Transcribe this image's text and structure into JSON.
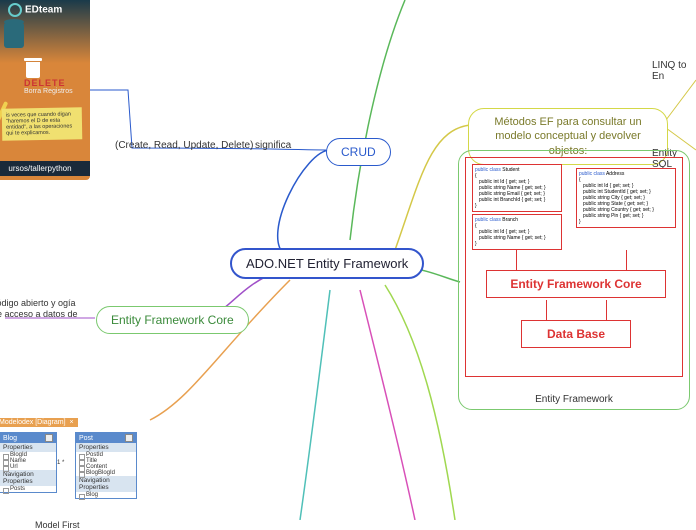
{
  "center": {
    "title": "ADO.NET Entity Framework"
  },
  "crud": {
    "label": "CRUD",
    "meaning_label": "significa",
    "expansion": "(Create, Read, Update, Delete)"
  },
  "efc": {
    "label": "Entity Framework Core",
    "description": "código abierto y\nogía de acceso a datos de"
  },
  "metodos": {
    "label": "Métodos EF para consultar un modelo conceptual y devolver objetos:",
    "child1": "LINQ to En",
    "child2": "Entity SQL"
  },
  "ef_diagram": {
    "caption": "Entity Framework",
    "efc_label": "Entity Framework Core",
    "db_label": "Data Base",
    "class_student": {
      "decl": "public class Student",
      "props": [
        "public int Id { get; set; }",
        "public string Name { get; set; }",
        "public string Email { get; set; }",
        "public int BranchId { get; set; }"
      ]
    },
    "class_branch": {
      "decl": "public class Branch",
      "props": [
        "public int Id { get; set; }",
        "public string Name { get; set; }"
      ]
    },
    "class_address": {
      "decl": "public class Address",
      "props": [
        "public int Id { get; set; }",
        "public int StudentId { get; set; }",
        "public string City { get; set; }",
        "public string State { get; set; }",
        "public string Country { get; set; }",
        "public string Pin { get; set; }"
      ]
    }
  },
  "edteam": {
    "logo": "EDteam",
    "delete_label": "DELETE",
    "delete_sub": "Borra Registros",
    "note": "is veces que cuando digan \"haremos el D de esta entidad\", a las operaciones qui te explicamos.",
    "link": "ursos/tallerpython"
  },
  "modelfirst": {
    "tab": "Modelodex [Diagram]",
    "title": "Model First",
    "blog": {
      "name": "Blog",
      "section1": "Properties",
      "props": [
        "BlogId",
        "Name",
        "Url"
      ],
      "section2": "Navigation Properties",
      "nav": [
        "Posts"
      ]
    },
    "post": {
      "name": "Post",
      "section1": "Properties",
      "props": [
        "PostId",
        "Title",
        "Content",
        "BlogBlogId"
      ],
      "section2": "Navigation Properties",
      "nav": [
        "Blog"
      ]
    },
    "relation": "1         *"
  }
}
